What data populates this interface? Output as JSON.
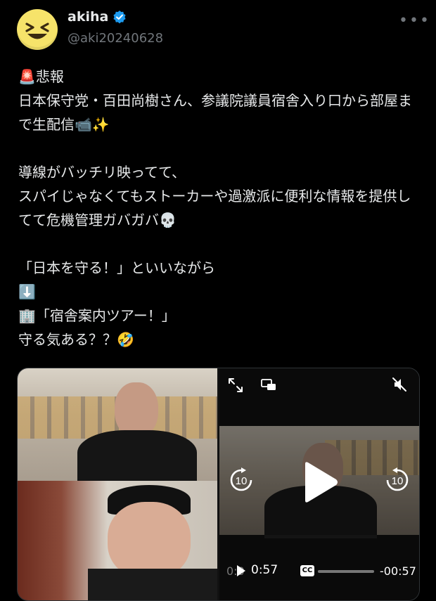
{
  "author": {
    "name": "akiha",
    "handle": "@aki20240628",
    "avatar_icon": "grinning-squinting-face-icon",
    "verified_icon": "verified-badge-icon",
    "verified_color": "#1d9bf0"
  },
  "more_label": "•••",
  "tweet_text": "🚨悲報\n日本保守党・百田尚樹さん、参議院議員宿舎入り口から部屋まで生配信📹✨\n\n導線がバッチリ映ってて、\nスパイじゃなくてもストーカーや過激派に便利な情報を提供してて危機管理ガバガバ💀\n\n「日本を守る！」といいながら\n⬇️\n🏢「宿舎案内ツアー！」\n守る気ある？？🤣",
  "video": {
    "current_time": "0:57",
    "remaining_time": "-00:57",
    "ghost_time": "0:0",
    "cc_label": "CC",
    "skip_back_label": "10",
    "skip_fwd_label": "10",
    "muted": true
  }
}
